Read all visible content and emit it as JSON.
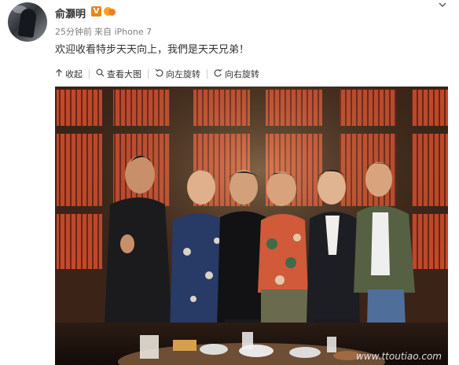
{
  "post": {
    "author": "俞灏明",
    "badge_v": "V",
    "time": "25分钟前",
    "source": "来自 iPhone 7",
    "text": "欢迎收看特步天天向上，我們是天天兄弟！",
    "menu_icon": "chevron-down-icon"
  },
  "toolbar": {
    "collapse": "收起",
    "view_large": "查看大图",
    "rotate_left": "向左旋转",
    "rotate_right": "向右旋转"
  },
  "photo": {
    "watermark": "www.ttoutiao.com"
  },
  "colors": {
    "badge_v": "#e8841a",
    "meta_gray": "#808080",
    "wall_red": "#c2472a",
    "wood_dark": "#3a2418"
  }
}
